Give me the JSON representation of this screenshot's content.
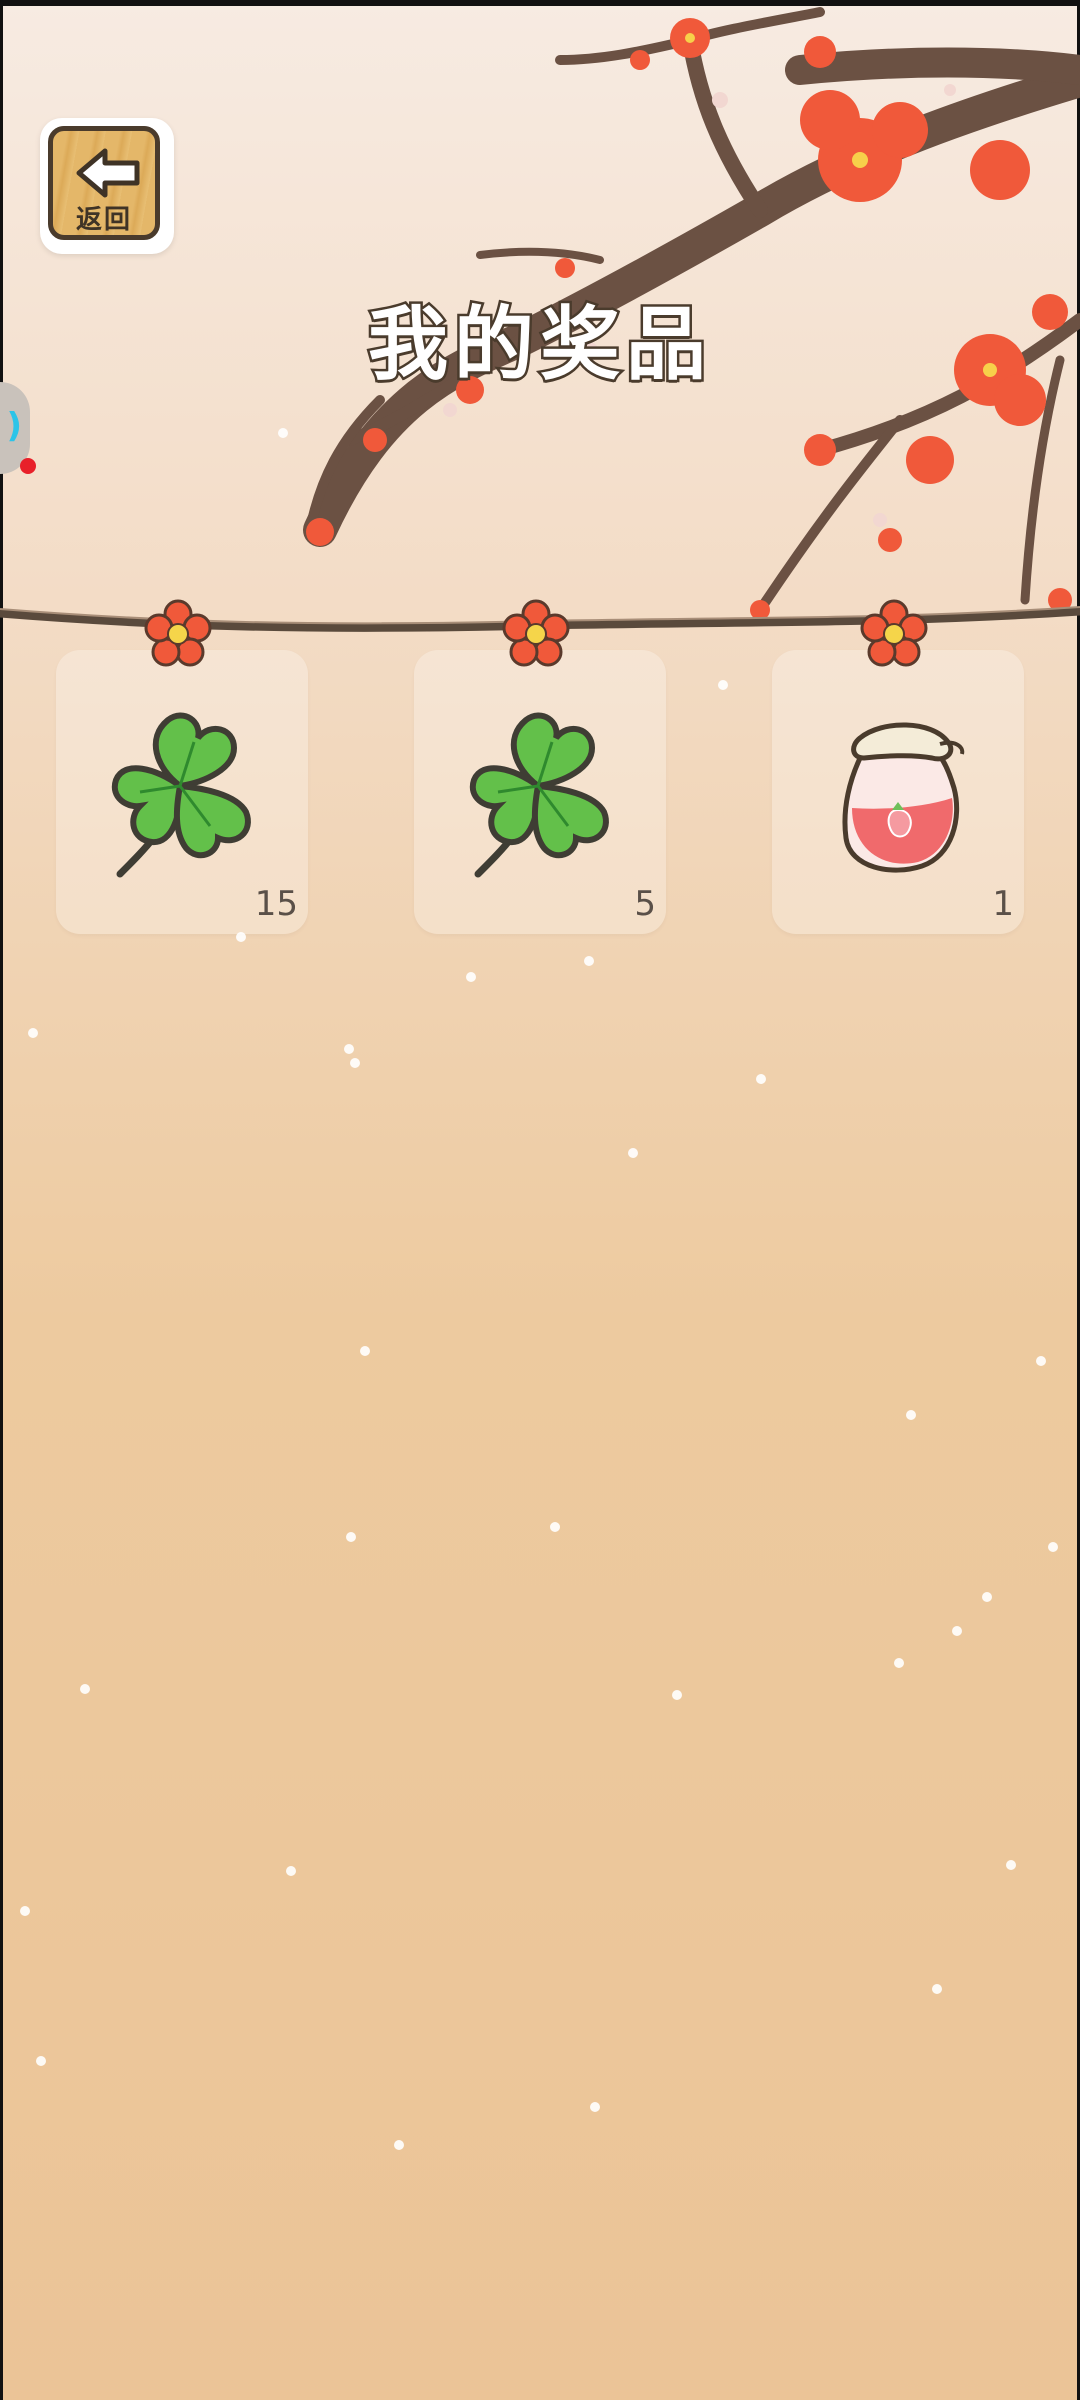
{
  "header": {
    "back_label": "返回",
    "title": "我的奖品"
  },
  "prizes": [
    {
      "name": "clover",
      "count": "15"
    },
    {
      "name": "clover",
      "count": "5"
    },
    {
      "name": "strawberry-jam-jar",
      "count": "1"
    }
  ],
  "colors": {
    "accent_flower": "#f0593a",
    "clover_green": "#63c04a",
    "outline": "#4a3b2c"
  }
}
